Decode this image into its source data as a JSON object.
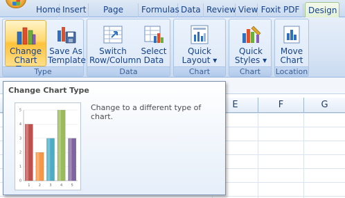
{
  "ribbon_tabs": [
    {
      "label": "Home"
    },
    {
      "label": "Insert"
    },
    {
      "label": "Page Layout"
    },
    {
      "label": "Formulas"
    },
    {
      "label": "Data"
    },
    {
      "label": "Review"
    },
    {
      "label": "View"
    },
    {
      "label": "Foxit PDF"
    },
    {
      "label": "Design",
      "active": true
    }
  ],
  "groups": {
    "type": {
      "label": "Type",
      "change_chart_type": "Change\nChart Type",
      "save_as_template": "Save As\nTemplate"
    },
    "data": {
      "label": "Data",
      "switch_row_column": "Switch\nRow/Column",
      "select_data": "Select\nData"
    },
    "chart_layouts": {
      "label": "Chart Layouts",
      "quick_layout": "Quick\nLayout ▾"
    },
    "chart_styles": {
      "label": "Chart Styles",
      "quick_styles": "Quick\nStyles ▾"
    },
    "location": {
      "label": "Location",
      "move_chart": "Move\nChart"
    }
  },
  "columns": [
    "E",
    "F",
    "G"
  ],
  "tooltip": {
    "title": "Change Chart Type",
    "description": "Change to a different type of chart."
  },
  "preview_chart": {
    "chart_data": {
      "type": "bar",
      "categories": [
        "1",
        "2",
        "3",
        "4",
        "5"
      ],
      "values": [
        4,
        2,
        3,
        5,
        3
      ],
      "ylim": [
        0,
        5
      ],
      "colors": [
        "#c0504d",
        "#f79646",
        "#4bacc6",
        "#9bbb59",
        "#8064a2"
      ]
    }
  },
  "colors": {
    "accent": "#15428b",
    "hover_gold": "#ffc23a"
  }
}
